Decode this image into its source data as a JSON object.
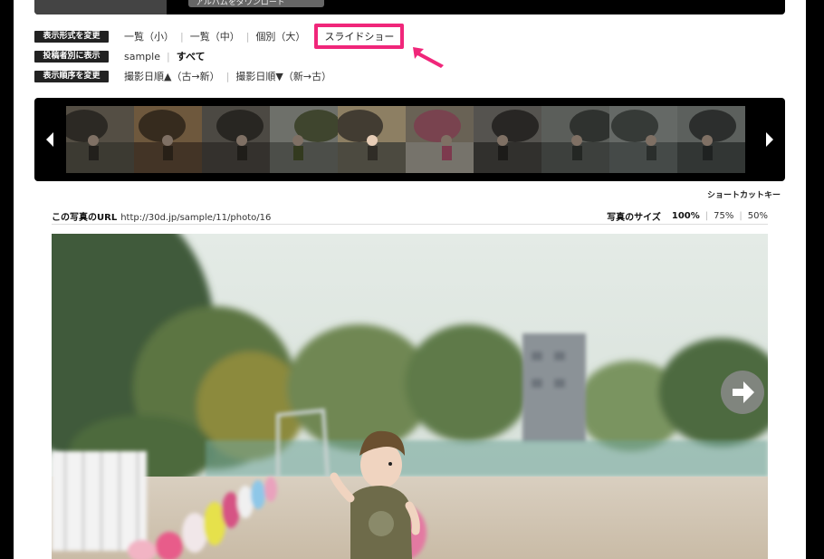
{
  "header": {
    "download_label": "アルバムをダウンロード"
  },
  "options": {
    "view_mode": {
      "label": "表示形式を変更",
      "items": [
        "一覧（小）",
        "一覧（中）",
        "個別（大）"
      ],
      "slideshow": "スライドショー"
    },
    "poster": {
      "label": "投稿者別に表示",
      "items": [
        "sample",
        "すべて"
      ]
    },
    "order": {
      "label": "表示順序を変更",
      "items": [
        "撮影日順▲（古→新）",
        "撮影日順▼（新→古）"
      ]
    }
  },
  "shortcut_label": "ショートカットキー",
  "photo_info": {
    "url_label": "この写真のURL",
    "url": "http://30d.jp/sample/11/photo/16",
    "size_label": "写真のサイズ",
    "sizes": [
      "100%",
      "75%",
      "50%"
    ],
    "current_size": "100%"
  },
  "thumbnail_strip": {
    "count": 10,
    "active_index": 4
  },
  "colors": {
    "highlight": "#f0267a",
    "background": "#000000",
    "panel": "#ffffff"
  }
}
